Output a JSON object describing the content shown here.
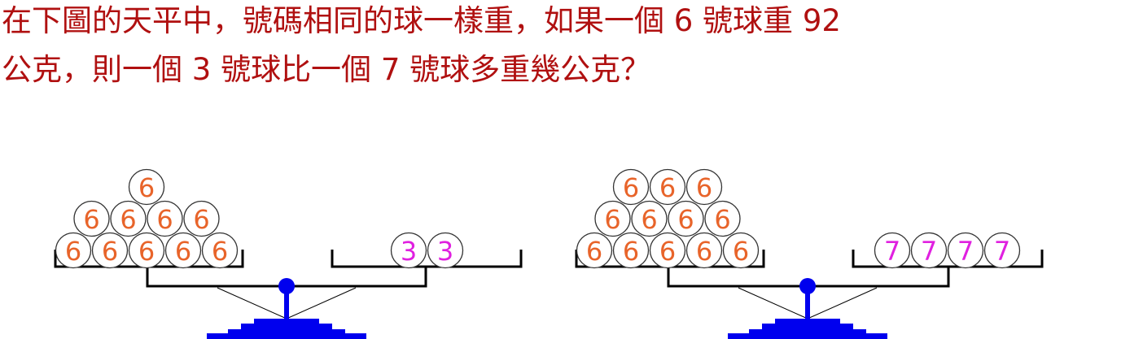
{
  "question": {
    "line1": "在下圖的天平中，號碼相同的球一樣重，如果一個 6 號球重 92",
    "line2": "公克，則一個 3 號球比一個 7 號球多重幾公克？"
  },
  "colors": {
    "question_text": "#b01010",
    "scale": "#0000ee",
    "pan_line": "#000000",
    "ball_outline": "#333333",
    "ball_6_text": "#e8642a",
    "ball_3_7_text": "#e020e0"
  },
  "scales": [
    {
      "left_pan": {
        "rows": [
          [
            "6"
          ],
          [
            "6",
            "6",
            "6",
            "6"
          ],
          [
            "6",
            "6",
            "6",
            "6",
            "6"
          ]
        ]
      },
      "right_pan": {
        "rows": [
          [
            "3",
            "3"
          ]
        ]
      }
    },
    {
      "left_pan": {
        "rows": [
          [
            "6",
            "6",
            "6"
          ],
          [
            "6",
            "6",
            "6",
            "6"
          ],
          [
            "6",
            "6",
            "6",
            "6",
            "6"
          ]
        ]
      },
      "right_pan": {
        "rows": [
          [
            "7",
            "7",
            "7",
            "7"
          ]
        ]
      }
    }
  ]
}
